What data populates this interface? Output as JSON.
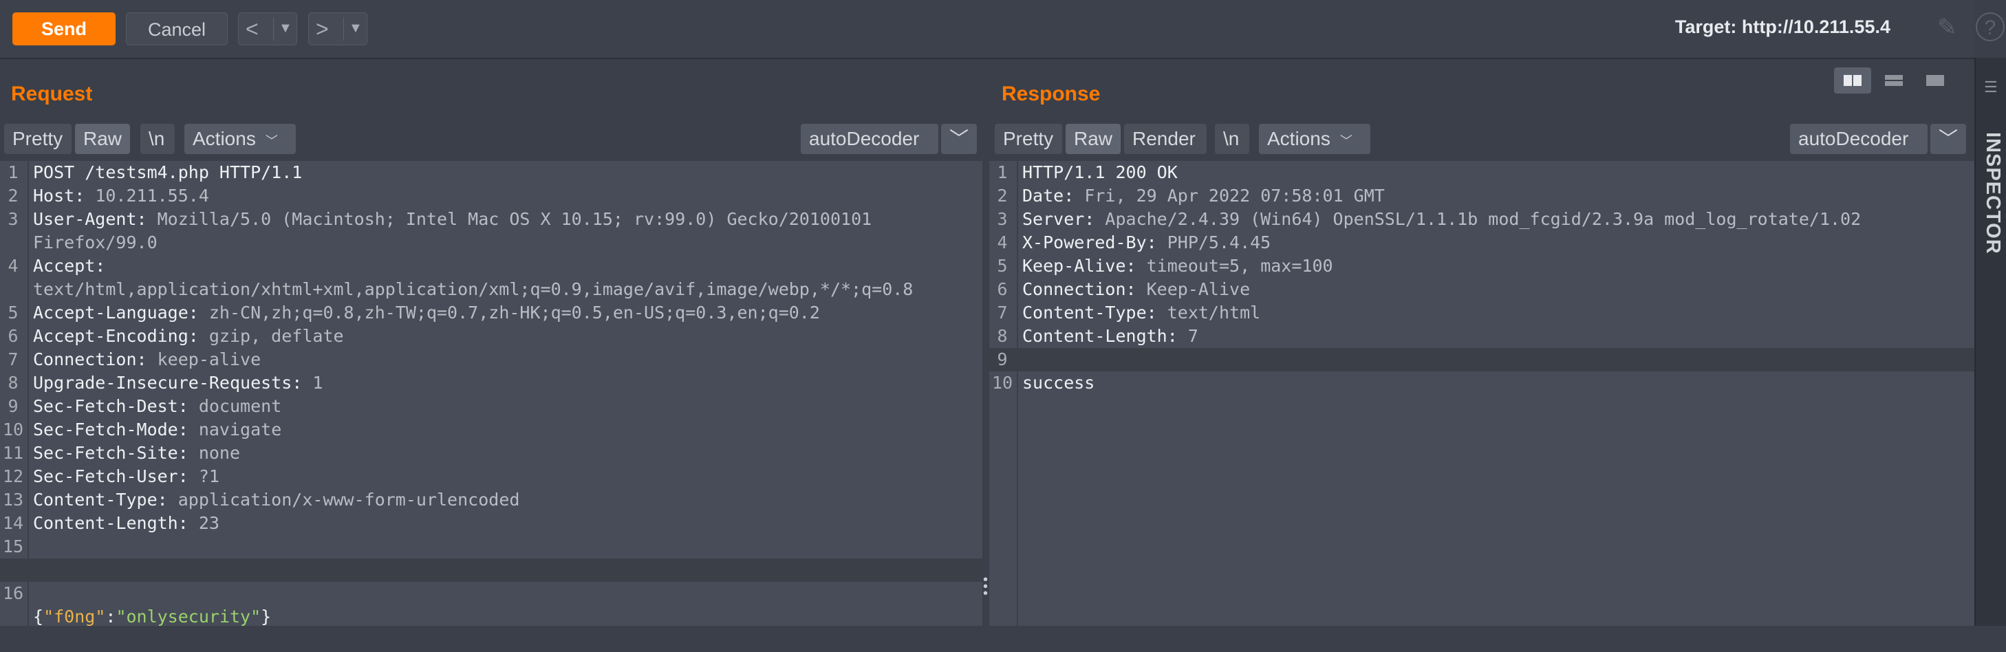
{
  "toolbar": {
    "send": "Send",
    "cancel": "Cancel",
    "target": "Target: http://10.211.55.4"
  },
  "inspector": {
    "label": "INSPECTOR"
  },
  "request": {
    "title": "Request",
    "tabs": [
      "Pretty",
      "Raw",
      "\\n",
      "Actions"
    ],
    "active_tab": "Raw",
    "decoder": "autoDecoder",
    "lines": [
      {
        "n": "1",
        "k": "POST /testsm4.php HTTP/1.1",
        "v": ""
      },
      {
        "n": "2",
        "k": "Host:",
        "v": " 10.211.55.4"
      },
      {
        "n": "3",
        "k": "User-Agent:",
        "v": " Mozilla/5.0 (Macintosh; Intel Mac OS X 10.15; rv:99.0) Gecko/20100101"
      },
      {
        "n": "",
        "k": "",
        "v": "Firefox/99.0"
      },
      {
        "n": "4",
        "k": "Accept:",
        "v": ""
      },
      {
        "n": "",
        "k": "",
        "v": "text/html,application/xhtml+xml,application/xml;q=0.9,image/avif,image/webp,*/*;q=0.8"
      },
      {
        "n": "5",
        "k": "Accept-Language:",
        "v": " zh-CN,zh;q=0.8,zh-TW;q=0.7,zh-HK;q=0.5,en-US;q=0.3,en;q=0.2"
      },
      {
        "n": "6",
        "k": "Accept-Encoding:",
        "v": " gzip, deflate"
      },
      {
        "n": "7",
        "k": "Connection:",
        "v": " keep-alive"
      },
      {
        "n": "8",
        "k": "Upgrade-Insecure-Requests:",
        "v": " 1"
      },
      {
        "n": "9",
        "k": "Sec-Fetch-Dest:",
        "v": " document"
      },
      {
        "n": "10",
        "k": "Sec-Fetch-Mode:",
        "v": " navigate"
      },
      {
        "n": "11",
        "k": "Sec-Fetch-Site:",
        "v": " none"
      },
      {
        "n": "12",
        "k": "Sec-Fetch-User:",
        "v": " ?1"
      },
      {
        "n": "13",
        "k": "Content-Type:",
        "v": " application/x-www-form-urlencoded"
      },
      {
        "n": "14",
        "k": "Content-Length:",
        "v": " 23"
      },
      {
        "n": "15",
        "k": "",
        "v": ""
      }
    ],
    "body_line": {
      "n": "16",
      "open": "{",
      "key": "\"f0ng\"",
      "colon": ":",
      "value": "\"onlysecurity\"",
      "close": "}"
    }
  },
  "response": {
    "title": "Response",
    "tabs": [
      "Pretty",
      "Raw",
      "Render",
      "\\n",
      "Actions"
    ],
    "active_tab": "Raw",
    "decoder": "autoDecoder",
    "lines": [
      {
        "n": "1",
        "k": "HTTP/1.1 200 OK",
        "v": ""
      },
      {
        "n": "2",
        "k": "Date:",
        "v": " Fri, 29 Apr 2022 07:58:01 GMT"
      },
      {
        "n": "3",
        "k": "Server:",
        "v": " Apache/2.4.39 (Win64) OpenSSL/1.1.1b mod_fcgid/2.3.9a mod_log_rotate/1.02"
      },
      {
        "n": "4",
        "k": "X-Powered-By:",
        "v": " PHP/5.4.45"
      },
      {
        "n": "5",
        "k": "Keep-Alive:",
        "v": " timeout=5, max=100"
      },
      {
        "n": "6",
        "k": "Connection:",
        "v": " Keep-Alive"
      },
      {
        "n": "7",
        "k": "Content-Type:",
        "v": " text/html"
      },
      {
        "n": "8",
        "k": "Content-Length:",
        "v": " 7"
      },
      {
        "n": "9",
        "k": "",
        "v": ""
      },
      {
        "n": "10",
        "k": "success",
        "v": ""
      }
    ]
  }
}
